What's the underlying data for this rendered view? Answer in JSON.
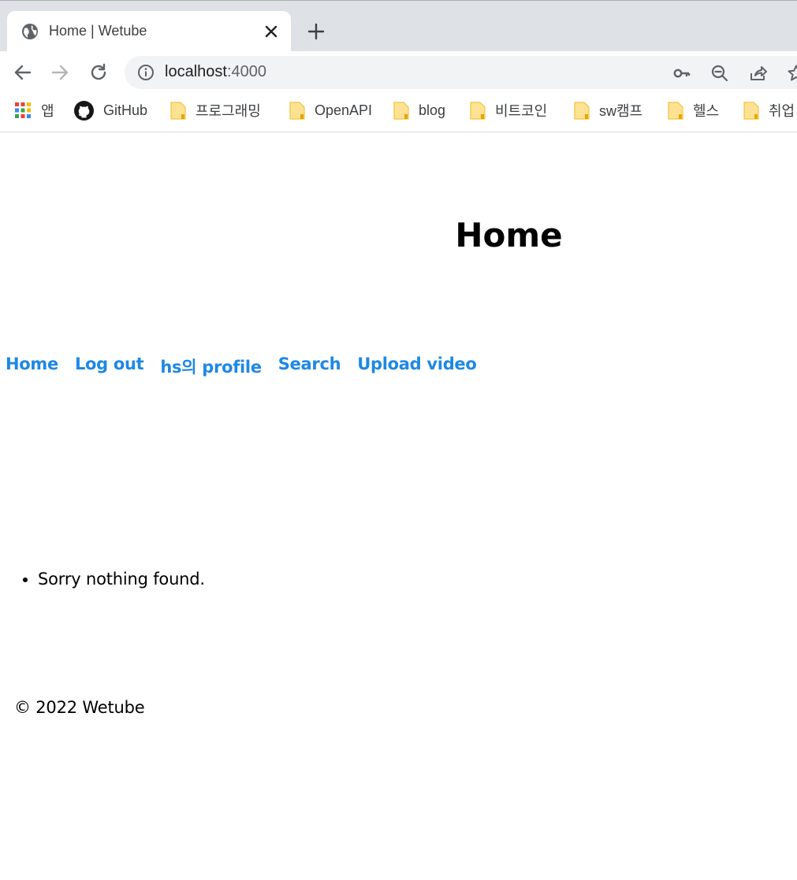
{
  "browser": {
    "tab": {
      "title": "Home | Wetube"
    },
    "address_bar": {
      "host": "localhost",
      "port": ":4000"
    },
    "bookmarks": [
      {
        "label": "앱",
        "icon": "apps-grid-icon"
      },
      {
        "label": "GitHub",
        "icon": "github-icon"
      },
      {
        "label": "프로그래밍",
        "icon": "folder-icon"
      },
      {
        "label": "OpenAPI",
        "icon": "folder-icon"
      },
      {
        "label": "blog",
        "icon": "folder-icon"
      },
      {
        "label": "비트코인",
        "icon": "folder-icon"
      },
      {
        "label": "sw캠프",
        "icon": "folder-icon"
      },
      {
        "label": "헬스",
        "icon": "folder-icon"
      },
      {
        "label": "취업",
        "icon": "folder-icon"
      }
    ]
  },
  "page": {
    "title": "Home",
    "nav": [
      {
        "label": "Home"
      },
      {
        "label": "Log out"
      },
      {
        "label": "hs의 profile"
      },
      {
        "label": "Search"
      },
      {
        "label": "Upload video"
      }
    ],
    "results": [
      "Sorry nothing found."
    ],
    "footer": "© 2022 Wetube"
  },
  "colors": {
    "link": "#1e88e5",
    "tabstrip": "#dee1e6",
    "omnibox": "#f1f3f4",
    "folder": "#fde293"
  }
}
